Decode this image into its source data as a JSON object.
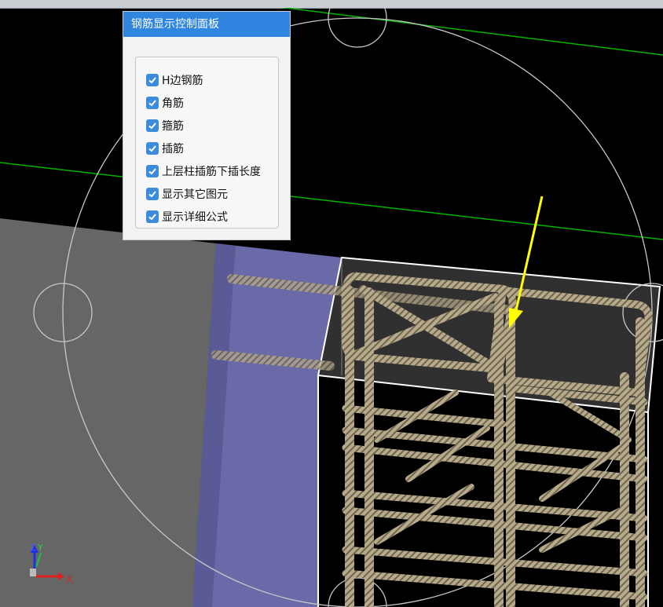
{
  "panel": {
    "title": "钢筋显示控制面板",
    "options": [
      {
        "label": "H边钢筋",
        "checked": true
      },
      {
        "label": "角筋",
        "checked": true
      },
      {
        "label": "箍筋",
        "checked": true
      },
      {
        "label": "插筋",
        "checked": true
      },
      {
        "label": "上层柱插筋下插长度",
        "checked": true
      },
      {
        "label": "显示其它图元",
        "checked": true
      },
      {
        "label": "显示详细公式",
        "checked": true
      }
    ]
  },
  "axis": {
    "z": "Z",
    "y": "Y",
    "x": "X"
  },
  "colors": {
    "panel_header": "#2f85e0",
    "checkbox": "#3d8bdb",
    "grid_line": "#00b400",
    "highlight_arrow": "#ffff00",
    "column_fill": "#6a6aa8",
    "floor_fill": "#666666"
  }
}
